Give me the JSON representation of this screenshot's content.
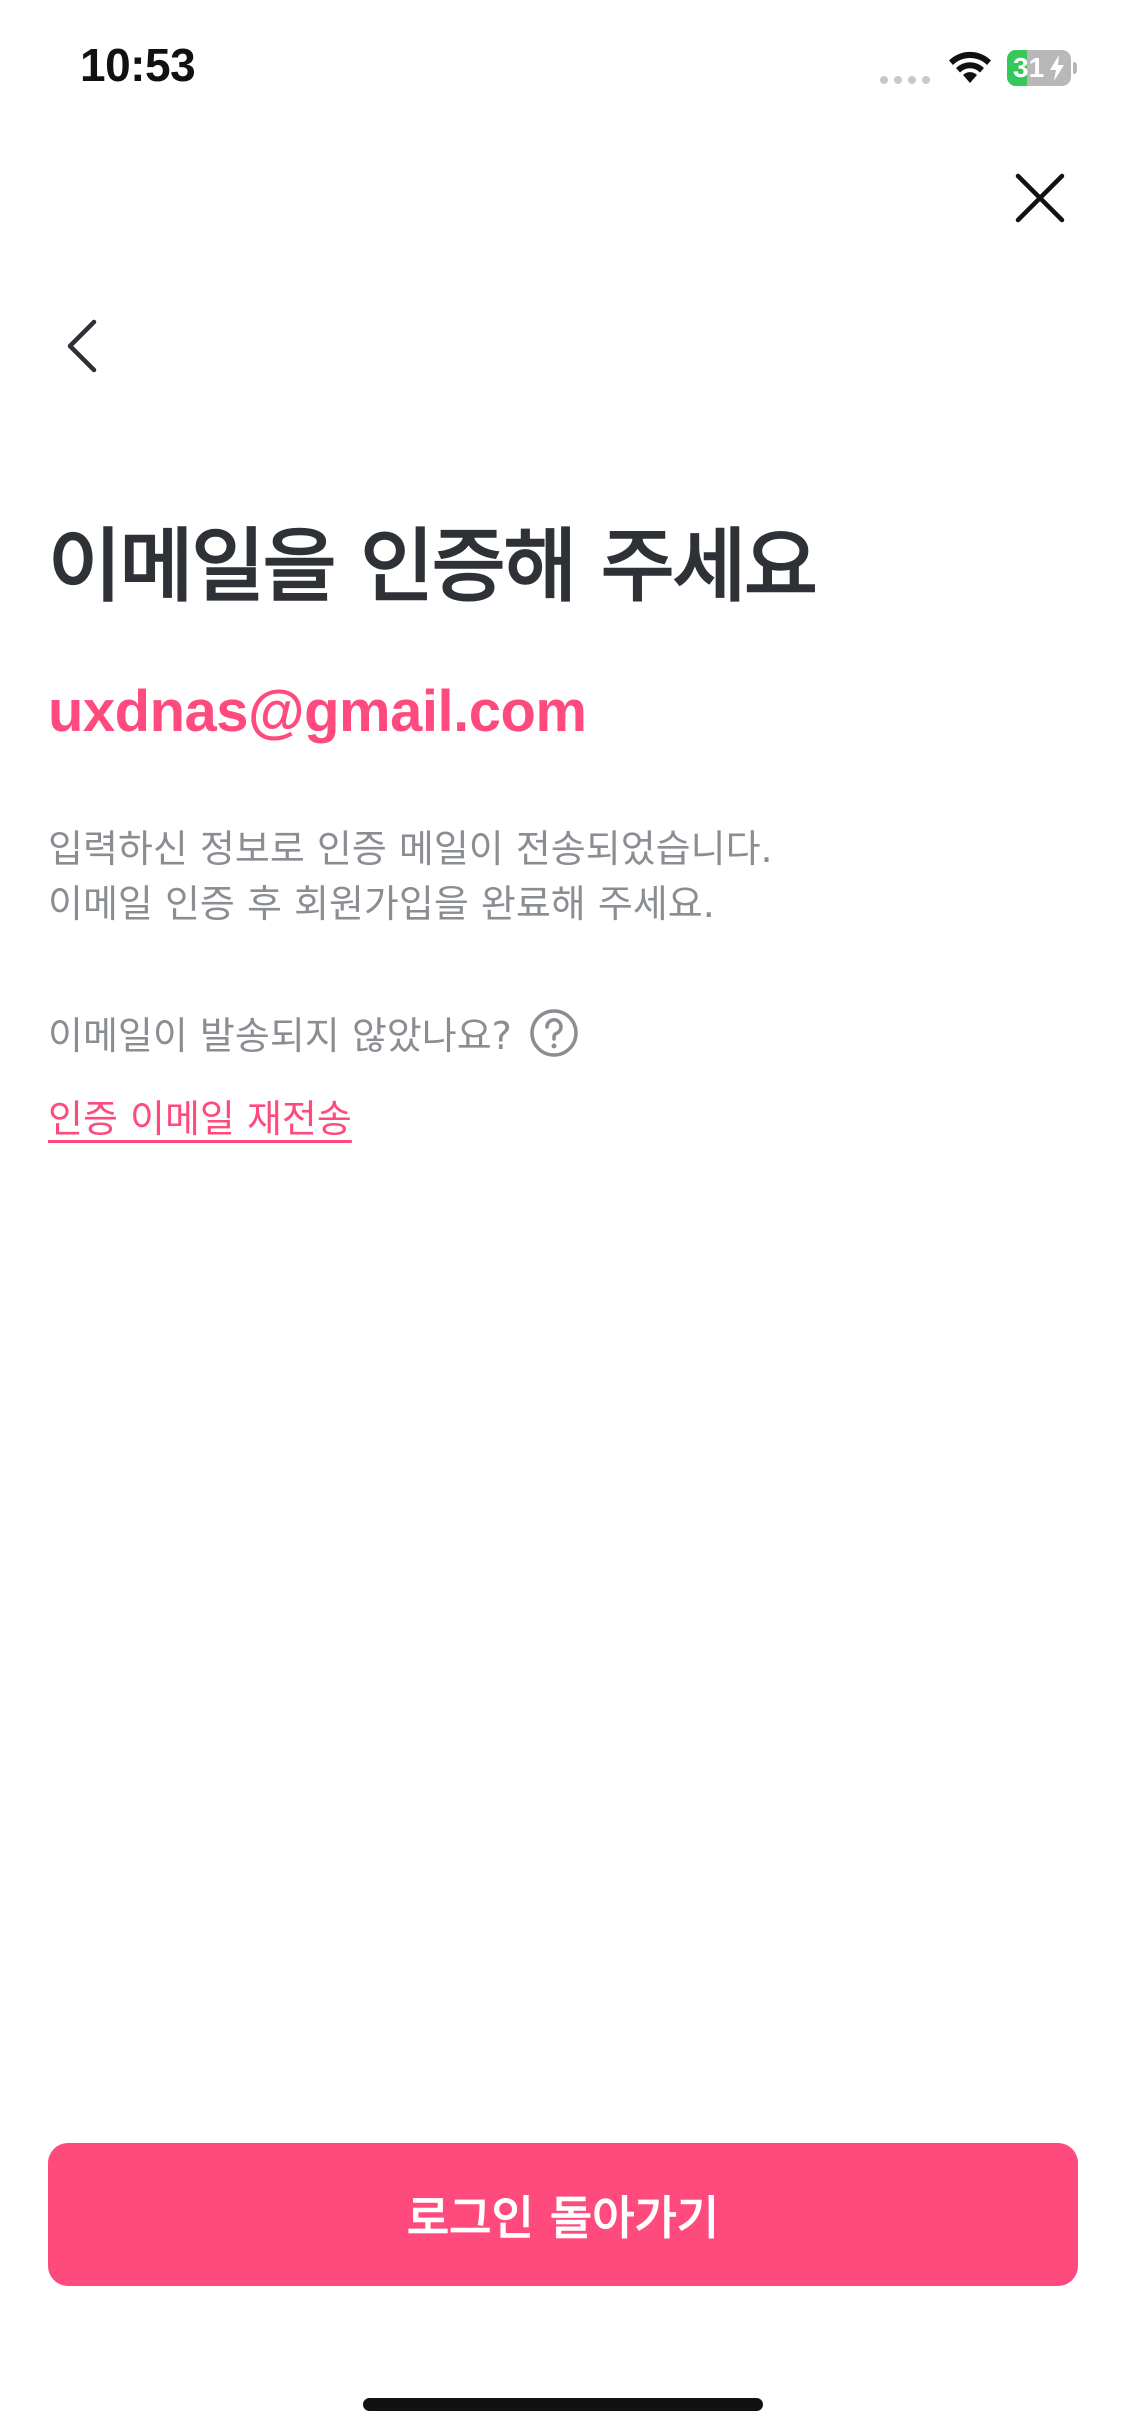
{
  "status_bar": {
    "time": "10:53",
    "battery_level": "31",
    "battery_fraction": 0.31,
    "icons": [
      "cellular-signal-icon",
      "wifi-icon",
      "battery-charging-icon"
    ]
  },
  "nav": {
    "close_icon": "close-icon",
    "back_icon": "chevron-left-icon"
  },
  "content": {
    "title": "이메일을 인증해 주세요",
    "email": "uxdnas@gmail.com",
    "description_line1": "입력하신 정보로 인증 메일이 전송되었습니다.",
    "description_line2": "이메일 인증 후 회원가입을 완료해 주세요.",
    "not_sent_question": "이메일이 발송되지 않았나요?",
    "help_icon": "question-circle-icon",
    "resend_link": "인증 이메일 재전송"
  },
  "footer": {
    "login_button_label": "로그인 돌아가기"
  },
  "colors": {
    "accent": "#ff4a7d",
    "title_text": "#2e3136",
    "secondary_text": "#8a8d92",
    "battery_green": "#34c759"
  }
}
